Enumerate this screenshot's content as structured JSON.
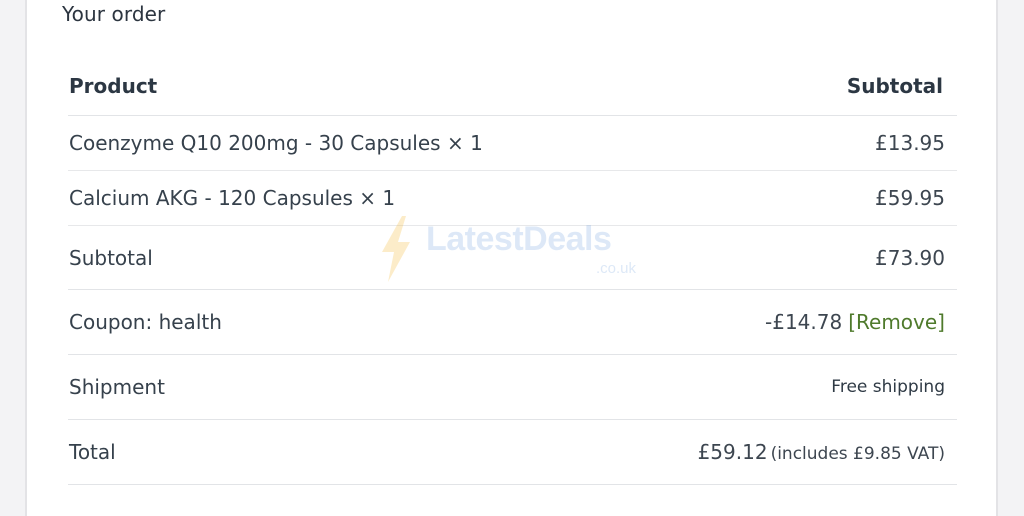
{
  "order": {
    "title": "Your order",
    "header": {
      "product": "Product",
      "subtotal": "Subtotal"
    },
    "items": [
      {
        "name": "Coenzyme Q10 200mg - 30 Capsules",
        "qty": "× 1",
        "price": "£13.95"
      },
      {
        "name": "Calcium AKG - 120 Capsules",
        "qty": "× 1",
        "price": "£59.95"
      }
    ],
    "subtotal": {
      "label": "Subtotal",
      "value": "£73.90"
    },
    "coupon": {
      "label": "Coupon: health",
      "value": "-£14.78",
      "remove_label": "[Remove]"
    },
    "shipment": {
      "label": "Shipment",
      "value": "Free shipping"
    },
    "total": {
      "label": "Total",
      "value": "£59.12",
      "vat_note": "(includes £9.85 VAT)"
    }
  },
  "watermark": {
    "brand": "LatestDeals",
    "domain": ".co.uk",
    "icon": "lightning-bolt-icon"
  },
  "colors": {
    "remove_link": "#4f7a2c",
    "text": "#36414c",
    "border": "#e2e4e7",
    "watermark": "#7aa8e0"
  }
}
